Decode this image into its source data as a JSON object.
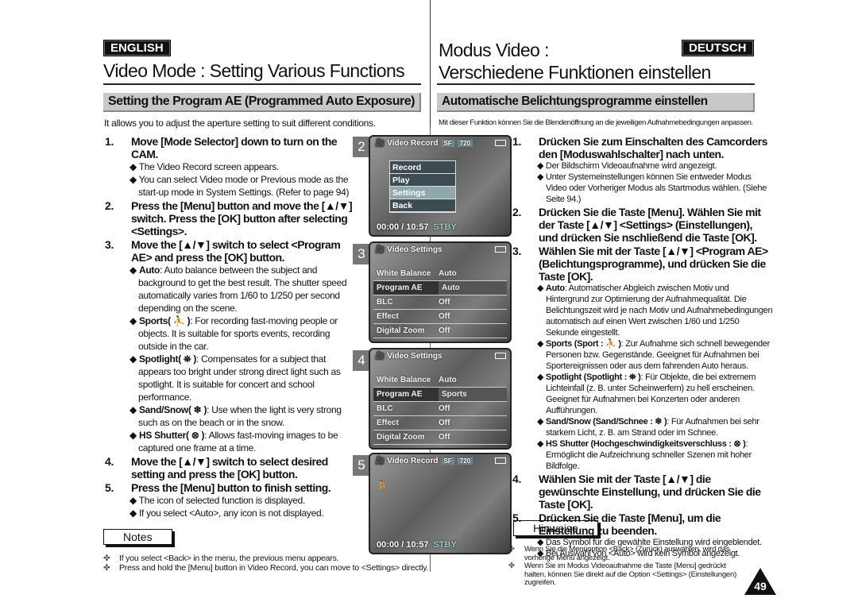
{
  "en": {
    "lang": "ENGLISH",
    "title": "Video Mode : Setting Various Functions",
    "section": "Setting the Program AE (Programmed Auto Exposure)",
    "intro": "It allows you to adjust the aperture setting to suit different conditions.",
    "steps": [
      {
        "n": "1.",
        "t": "Move [Mode Selector] down to turn on the CAM.",
        "b": [
          "The Video Record screen appears.",
          "You can select Video mode or Previous mode as the start-up mode in System Settings. (Refer to page 94)"
        ]
      },
      {
        "n": "2.",
        "t": "Press the [Menu] button and move the [▲/▼] switch. Press the [OK] button after selecting <Settings>.",
        "b": []
      },
      {
        "n": "3.",
        "t": "Move the [▲/▼] switch to select <Program AE> and press the [OK] button.",
        "b": []
      },
      {
        "n": "4.",
        "t": "Move the [▲/▼] switch to select desired setting and press the [OK] button.",
        "b": []
      },
      {
        "n": "5.",
        "t": "Press the [Menu] button to finish setting.",
        "b": [
          "The icon of selected function is displayed.",
          "If you select <Auto>, any icon is not displayed."
        ]
      }
    ],
    "modes": [
      {
        "k": "Auto",
        "d": ": Auto balance between the subject and background to get the best result. The shutter speed automatically varies from 1/60 to 1/250 per second depending on the scene."
      },
      {
        "k": "Sports( ⛹ )",
        "d": ": For recording fast-moving people or objects. It is suitable for sports events, recording outside in the car."
      },
      {
        "k": "Spotlight( ⛯ )",
        "d": ": Compensates for a subject that appears too bright under strong direct light such as spotlight. It is suitable for concert and school performance."
      },
      {
        "k": "Sand/Snow( ❄ )",
        "d": ": Use when the light is very strong such as on the beach or in the snow."
      },
      {
        "k": "HS Shutter( ⊗ )",
        "d": ": Allows fast-moving images to be captured one frame at a time."
      }
    ],
    "notes_title": "Notes",
    "notes": [
      "If you select <Back> in the menu, the previous menu appears.",
      "Press and hold the [Menu] button in Video Record, you can move to <Settings> directly."
    ]
  },
  "de": {
    "lang": "DEUTSCH",
    "title1": "Modus Video :",
    "title2": "Verschiedene Funktionen einstellen",
    "section": "Automatische Belichtungsprogramme einstellen",
    "intro": "Mit dieser Funktion können Sie die Blendenöffnung an die jeweiligen Aufnahmebedingungen anpassen.",
    "steps": [
      {
        "n": "1.",
        "t": "Drücken Sie zum Einschalten des Camcorders den [Moduswahlschalter] nach unten.",
        "b": [
          "Der Bildschirm Videoaufnahme wird angezeigt.",
          "Unter Systemeinstellungen können Sie entweder Modus Video oder Vorheriger Modus als Startmodus wählen. (Siehe Seite 94.)"
        ]
      },
      {
        "n": "2.",
        "t": "Drücken Sie die Taste [Menu]. Wählen Sie mit der Taste [▲/▼] <Settings> (Einstellungen), und drücken Sie nschließend die Taste [OK].",
        "b": []
      },
      {
        "n": "3.",
        "t": "Wählen Sie mit der Taste [▲/▼] <Program AE> (Belichtungsprogramme), und drücken Sie die Taste [OK].",
        "b": []
      },
      {
        "n": "4.",
        "t": "Wählen Sie mit der Taste [▲/▼] die gewünschte Einstellung, und drücken Sie die Taste [OK].",
        "b": []
      },
      {
        "n": "5.",
        "t": "Drücken Sie die Taste [Menu], um die Einstellung zu beenden.",
        "b": [
          "Das Symbol für die gewählte Einstellung wird eingeblendet.",
          "Bei Auswahl von <Auto> wird kein Symbol angezeigt."
        ]
      }
    ],
    "modes": [
      {
        "k": "Auto",
        "d": ": Automatischer Abgleich zwischen Motiv und Hintergrund zur Optimierung der Aufnahmequalität. Die Belichtungszeit wird je nach Motiv und Aufnahmebedingungen automatisch auf einen Wert zwischen 1/60 und 1/250 Sekunde eingestellt."
      },
      {
        "k": "Sports (Sport : ⛹ )",
        "d": ": Zur Aufnahme sich schnell bewegender Personen bzw. Gegenstände. Geeignet für Aufnahmen bei Sportereignissen oder aus dem fahrenden Auto heraus."
      },
      {
        "k": "Spotlight (Spotlight : ⛯ )",
        "d": ": Für Objekte, die bei extremem Lichteinfall (z. B. unter Scheinwerfern) zu hell erscheinen. Geeignet für Aufnahmen bei Konzerten oder anderen Aufführungen."
      },
      {
        "k": "Sand/Snow (Sand/Schnee : ❄ )",
        "d": ": Für Aufnahmen bei sehr starkem Licht, z. B. am Strand oder im Schnee."
      },
      {
        "k": "HS Shutter (Hochgeschwindigkeitsverschluss : ⊗ )",
        "d": ": Ermöglicht die Aufzeichnung schneller Szenen mit hoher Bildfolge."
      }
    ],
    "notes_title": "Hinweise",
    "notes": [
      "Wenn Sie die Menüoption <Back> (Zurück) auswählen, wird das vorherige Menü angezeigt.",
      "Wenn Sie im Modus Videoaufnahme die Taste [Menu] gedrückt halten, können Sie direkt auf die Option <Settings> (Einstellungen) zugreifen."
    ]
  },
  "screens": {
    "s2": {
      "num": "2",
      "head": "Video Record",
      "q1": "SF",
      "q2": "720",
      "menu": [
        "Record",
        "Play",
        "Settings",
        "Back"
      ],
      "selected": "Settings",
      "time": "00:00 / 10:57",
      "status": "STBY"
    },
    "s3": {
      "num": "3",
      "head": "Video Settings",
      "rows": [
        [
          "White Balance",
          "Auto"
        ],
        [
          "Program AE",
          "Auto"
        ],
        [
          "BLC",
          "Off"
        ],
        [
          "Effect",
          "Off"
        ],
        [
          "Digital Zoom",
          "Off"
        ]
      ]
    },
    "s4": {
      "num": "4",
      "head": "Video Settings",
      "rows": [
        [
          "White Balance",
          "Auto"
        ],
        [
          "Program AE",
          "Sports"
        ],
        [
          "BLC",
          "Off"
        ],
        [
          "Effect",
          "Off"
        ],
        [
          "Digital Zoom",
          "Off"
        ]
      ]
    },
    "s5": {
      "num": "5",
      "head": "Video Record",
      "q1": "SF",
      "q2": "720",
      "time": "00:00 / 10:57",
      "status": "STBY"
    }
  },
  "page_number": "49"
}
